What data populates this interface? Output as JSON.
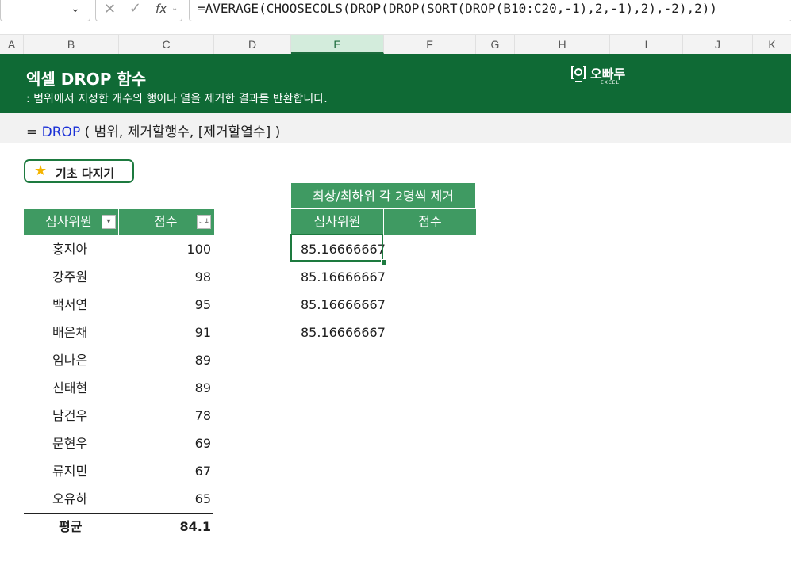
{
  "formula_bar": {
    "formula": "=AVERAGE(CHOOSECOLS(DROP(DROP(SORT(DROP(B10:C20,-1),2,-1),2),-2),2))",
    "fx_label": "fx"
  },
  "columns": [
    "A",
    "B",
    "C",
    "D",
    "E",
    "F",
    "G",
    "H",
    "I",
    "J",
    "K"
  ],
  "banner": {
    "title": "엑셀 DROP 함수",
    "subtitle": ": 범위에서 지정한 개수의 행이나 열을 제거한 결과를 반환합니다.",
    "logo_text": "오빠두",
    "logo_sub": "EXCEL"
  },
  "syntax": {
    "eq": "=",
    "fn": "DROP",
    "args": "( 범위, 제거할행수, [제거할열수] )"
  },
  "basic_button": {
    "label": "기초 다지기"
  },
  "left_table": {
    "headers": [
      "심사위원",
      "점수"
    ],
    "rows": [
      {
        "name": "홍지아",
        "score": "100"
      },
      {
        "name": "강주원",
        "score": "98"
      },
      {
        "name": "백서연",
        "score": "95"
      },
      {
        "name": "배은채",
        "score": "91"
      },
      {
        "name": "임나은",
        "score": "89"
      },
      {
        "name": "신태현",
        "score": "89"
      },
      {
        "name": "남건우",
        "score": "78"
      },
      {
        "name": "문현우",
        "score": "69"
      },
      {
        "name": "류지민",
        "score": "67"
      },
      {
        "name": "오유하",
        "score": "65"
      }
    ],
    "avg_label": "평균",
    "avg_value": "84.1"
  },
  "right_table": {
    "title": "최상/최하위 각 2명씩 제거",
    "headers": [
      "심사위원",
      "점수"
    ],
    "values": [
      "85.16666667",
      "85.16666667",
      "85.16666667",
      "85.16666667"
    ]
  },
  "colors": {
    "banner": "#0f6a35",
    "header": "#3f9a62",
    "accent": "#1d7a3f"
  }
}
